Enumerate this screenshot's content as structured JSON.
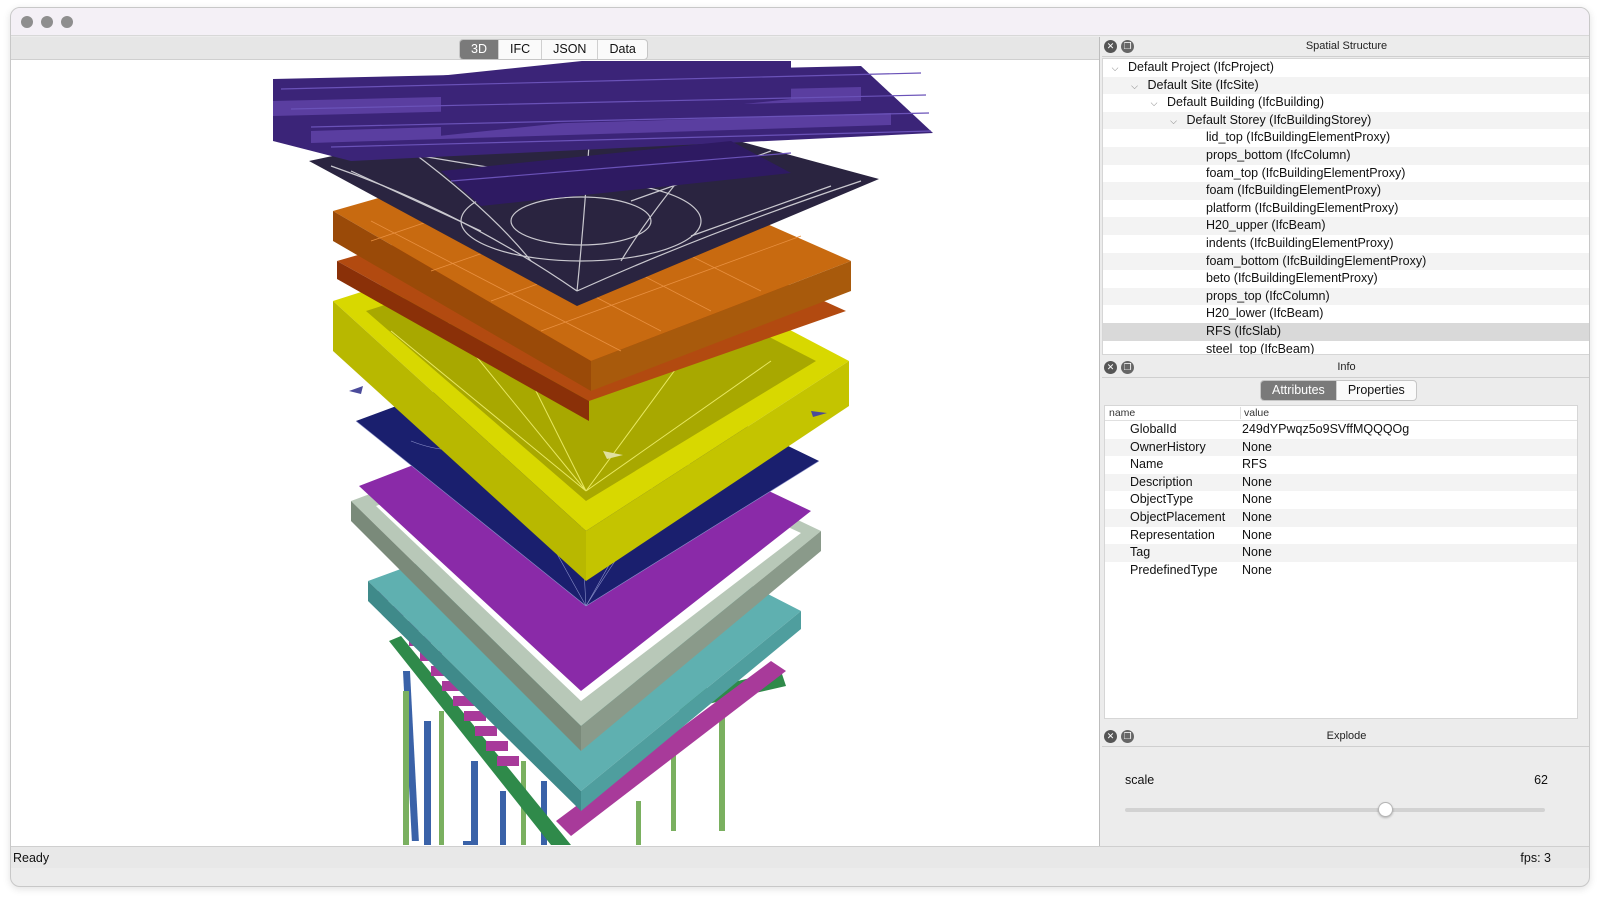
{
  "viewer": {
    "tabs": [
      {
        "label": "3D",
        "active": true
      },
      {
        "label": "IFC",
        "active": false
      },
      {
        "label": "JSON",
        "active": false
      },
      {
        "label": "Data",
        "active": false
      }
    ]
  },
  "spatial": {
    "title": "Spatial Structure",
    "rows": [
      {
        "label": "Default Project (IfcProject)",
        "level": 0,
        "expanded": true
      },
      {
        "label": "Default Site (IfcSite)",
        "level": 1,
        "expanded": true
      },
      {
        "label": "Default Building (IfcBuilding)",
        "level": 2,
        "expanded": true
      },
      {
        "label": "Default Storey (IfcBuildingStorey)",
        "level": 3,
        "expanded": true
      },
      {
        "label": "lid_top (IfcBuildingElementProxy)",
        "level": 4
      },
      {
        "label": "props_bottom (IfcColumn)",
        "level": 4
      },
      {
        "label": "foam_top (IfcBuildingElementProxy)",
        "level": 4
      },
      {
        "label": "foam (IfcBuildingElementProxy)",
        "level": 4
      },
      {
        "label": "platform (IfcBuildingElementProxy)",
        "level": 4
      },
      {
        "label": "H20_upper (IfcBeam)",
        "level": 4
      },
      {
        "label": "indents (IfcBuildingElementProxy)",
        "level": 4
      },
      {
        "label": "foam_bottom (IfcBuildingElementProxy)",
        "level": 4
      },
      {
        "label": "beto (IfcBuildingElementProxy)",
        "level": 4
      },
      {
        "label": "props_top (IfcColumn)",
        "level": 4
      },
      {
        "label": "H20_lower (IfcBeam)",
        "level": 4
      },
      {
        "label": "RFS (IfcSlab)",
        "level": 4,
        "selected": true
      },
      {
        "label": "steel_top (IfcBeam)",
        "level": 4
      }
    ]
  },
  "info": {
    "title": "Info",
    "tabs": [
      {
        "label": "Attributes",
        "active": true
      },
      {
        "label": "Properties",
        "active": false
      }
    ],
    "col_name": "name",
    "col_value": "value",
    "rows": [
      {
        "name": "GlobalId",
        "value": "249dYPwqz5o9SVffMQQQOg"
      },
      {
        "name": "OwnerHistory",
        "value": "None"
      },
      {
        "name": "Name",
        "value": "RFS"
      },
      {
        "name": "Description",
        "value": "None"
      },
      {
        "name": "ObjectType",
        "value": "None"
      },
      {
        "name": "ObjectPlacement",
        "value": "None"
      },
      {
        "name": "Representation",
        "value": "None"
      },
      {
        "name": "Tag",
        "value": "None"
      },
      {
        "name": "PredefinedType",
        "value": "None"
      }
    ]
  },
  "explode": {
    "title": "Explode",
    "scale_label": "scale",
    "scale_value": "62",
    "slider_fraction": 0.62
  },
  "status": {
    "left": "Ready",
    "right": "fps: 3"
  },
  "colors": {
    "beams_top": "#3b2478",
    "foam": "#c86a10",
    "yellow": "#d8d800",
    "navy": "#1a1f6e",
    "purple": "#8a2aa8",
    "teal": "#5fb0b0",
    "columns_blue": "#3a62a8",
    "columns_green": "#7ab060",
    "beam_magenta": "#a83a9a"
  }
}
